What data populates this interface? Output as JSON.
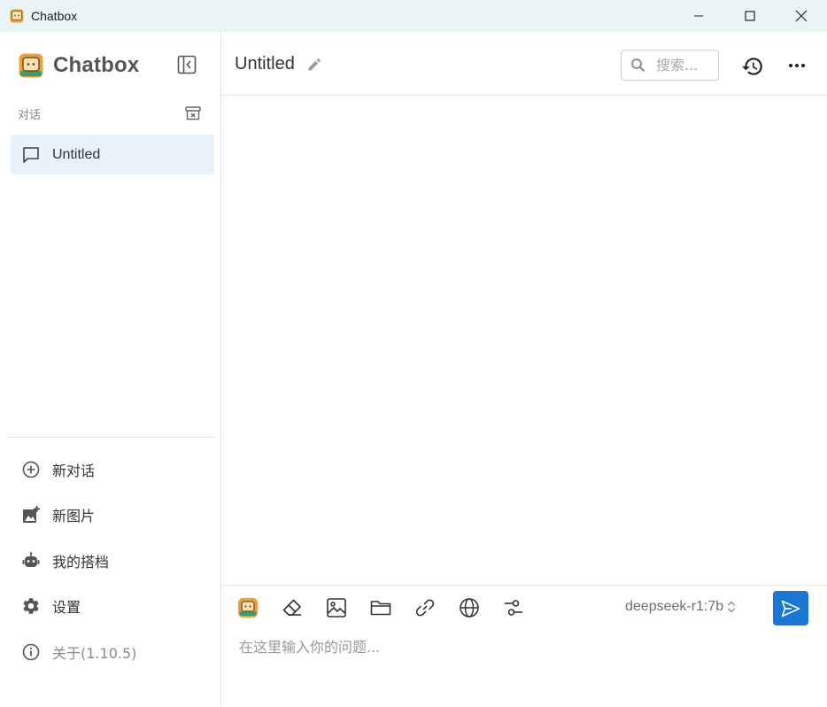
{
  "window": {
    "title": "Chatbox",
    "icons": {
      "app": "chatbox-logo-icon",
      "minimize": "minimize-icon",
      "maximize": "maximize-icon",
      "close": "close-icon"
    }
  },
  "sidebar": {
    "brand": "Chatbox",
    "section_label": "对话",
    "conversations": [
      {
        "label": "Untitled",
        "icon": "chat-bubble-icon"
      }
    ],
    "menu": [
      {
        "label": "新对话",
        "icon": "add-circle-icon"
      },
      {
        "label": "新图片",
        "icon": "add-image-icon"
      },
      {
        "label": "我的搭档",
        "icon": "robot-icon"
      },
      {
        "label": "设置",
        "icon": "gear-icon"
      },
      {
        "label": "关于(1.10.5)",
        "icon": "info-icon"
      }
    ]
  },
  "header": {
    "title": "Untitled",
    "search_placeholder": "搜索..."
  },
  "composer": {
    "model": "deepseek-r1:7b",
    "placeholder": "在这里输入你的问题...",
    "value": "",
    "tools": [
      "chatbox-logo-icon",
      "eraser-icon",
      "image-icon",
      "folder-icon",
      "link-icon",
      "globe-icon",
      "settings-sliders-icon"
    ]
  },
  "colors": {
    "accent": "#1976d2",
    "selected_bg": "#e9f1fb",
    "titlebar_bg": "#eaf4f7",
    "logo_orange": "#e9a23b",
    "logo_green": "#3c9d6c"
  }
}
